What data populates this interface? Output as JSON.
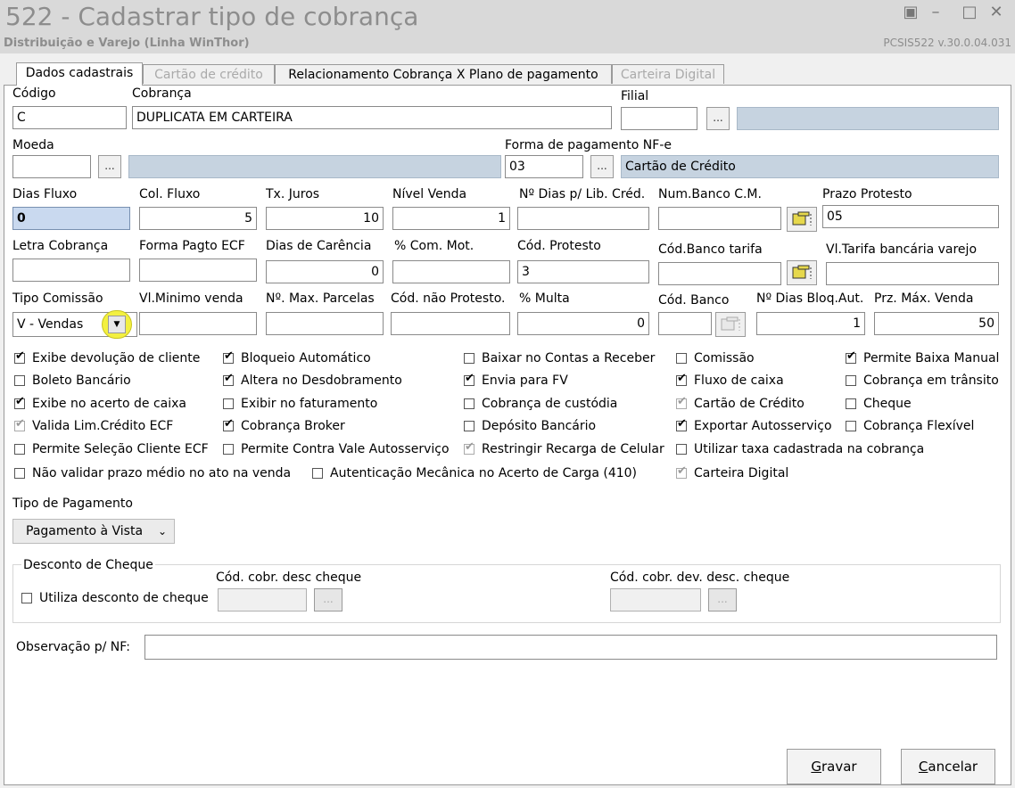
{
  "window": {
    "title": "522 - Cadastrar tipo de cobrança",
    "subtitle": "Distribuição e Varejo (Linha WinThor)",
    "version": "PCSIS522  v.30.0.04.031"
  },
  "tabs": [
    {
      "label": "Dados cadastrais"
    },
    {
      "label": "Cartão de crédito"
    },
    {
      "label": "Relacionamento Cobrança X Plano de pagamento"
    },
    {
      "label": "Carteira Digital"
    }
  ],
  "fields": {
    "codigo": {
      "label": "Código",
      "value": "C"
    },
    "cobranca": {
      "label": "Cobrança",
      "value": "DUPLICATA EM CARTEIRA"
    },
    "filial": {
      "label": "Filial",
      "value": ""
    },
    "moeda": {
      "label": "Moeda",
      "value": ""
    },
    "forma_pagamento_nfe": {
      "label": "Forma de pagamento NF-e",
      "value": "03",
      "desc": "Cartão de Crédito"
    },
    "dias_fluxo": {
      "label": "Dias Fluxo",
      "value": "0"
    },
    "col_fluxo": {
      "label": "Col. Fluxo",
      "value": "5"
    },
    "tx_juros": {
      "label": "Tx. Juros",
      "value": "10"
    },
    "nivel_venda": {
      "label": "Nível Venda",
      "value": "1"
    },
    "dias_lib_cred": {
      "label": "Nº Dias p/ Lib. Créd.",
      "value": ""
    },
    "num_banco_cm": {
      "label": "Num.Banco C.M.",
      "value": ""
    },
    "prazo_protesto": {
      "label": "Prazo Protesto",
      "value": "05"
    },
    "letra_cobranca": {
      "label": "Letra Cobrança",
      "value": ""
    },
    "forma_pagto_ecf": {
      "label": "Forma Pagto ECF",
      "value": ""
    },
    "dias_carencia": {
      "label": "Dias de Carência",
      "value": "0"
    },
    "com_mot": {
      "label": "% Com. Mot.",
      "value": ""
    },
    "cod_protesto": {
      "label": "Cód. Protesto",
      "value": "3"
    },
    "cod_banco_tarifa": {
      "label": "Cód.Banco tarifa",
      "value": ""
    },
    "vl_tarifa": {
      "label": "Vl.Tarifa bancária varejo",
      "value": ""
    },
    "tipo_comissao": {
      "label": "Tipo Comissão",
      "value": "V - Vendas"
    },
    "vl_minimo_venda": {
      "label": "Vl.Minimo venda",
      "value": ""
    },
    "max_parcelas": {
      "label": "Nº. Max. Parcelas",
      "value": ""
    },
    "cod_nao_protesto": {
      "label": "Cód. não Protesto.",
      "value": ""
    },
    "multa": {
      "label": "% Multa",
      "value": "0"
    },
    "cod_banco": {
      "label": "Cód. Banco",
      "value": ""
    },
    "dias_bloq_aut": {
      "label": "Nº Dias Bloq.Aut.",
      "value": "1"
    },
    "prz_max_venda": {
      "label": "Prz. Máx. Venda",
      "value": "50"
    }
  },
  "checkboxes": [
    {
      "label": "Exibe devolução de cliente",
      "checked": true,
      "disabled": false
    },
    {
      "label": "Bloqueio Automático",
      "checked": true,
      "disabled": false
    },
    {
      "label": "Baixar no Contas a Receber",
      "checked": false,
      "disabled": false
    },
    {
      "label": "Comissão",
      "checked": false,
      "disabled": false
    },
    {
      "label": "Permite Baixa Manual",
      "checked": true,
      "disabled": false
    },
    {
      "label": "Boleto Bancário",
      "checked": false,
      "disabled": false
    },
    {
      "label": "Altera no Desdobramento",
      "checked": true,
      "disabled": false
    },
    {
      "label": "Envia para FV",
      "checked": true,
      "disabled": false
    },
    {
      "label": "Fluxo de caixa",
      "checked": true,
      "disabled": false
    },
    {
      "label": "Cobrança em trânsito",
      "checked": false,
      "disabled": false
    },
    {
      "label": "Exibe no acerto de caixa",
      "checked": true,
      "disabled": false
    },
    {
      "label": "Exibir no faturamento",
      "checked": false,
      "disabled": false
    },
    {
      "label": "Cobrança de custódia",
      "checked": false,
      "disabled": false
    },
    {
      "label": "Cartão de Crédito",
      "checked": true,
      "disabled": true
    },
    {
      "label": "Cheque",
      "checked": false,
      "disabled": false
    },
    {
      "label": "Valida Lim.Crédito ECF",
      "checked": true,
      "disabled": true
    },
    {
      "label": "Cobrança Broker",
      "checked": true,
      "disabled": false
    },
    {
      "label": "Depósito Bancário",
      "checked": false,
      "disabled": false
    },
    {
      "label": "Exportar Autosserviço",
      "checked": true,
      "disabled": false
    },
    {
      "label": "Cobrança Flexível",
      "checked": false,
      "disabled": false
    },
    {
      "label": "Permite Seleção Cliente ECF",
      "checked": false,
      "disabled": false
    },
    {
      "label": "Permite Contra Vale Autosserviço",
      "checked": false,
      "disabled": false
    },
    {
      "label": "Restringir Recarga de Celular",
      "checked": true,
      "disabled": true
    },
    {
      "label": "Utilizar taxa cadastrada na cobrança",
      "checked": false,
      "disabled": false
    },
    {
      "label": "Não validar prazo médio no ato na venda",
      "checked": false,
      "disabled": false
    },
    {
      "label": "Autenticação Mecânica no Acerto de Carga (410)",
      "checked": false,
      "disabled": false
    },
    {
      "label": "Carteira Digital",
      "checked": true,
      "disabled": true
    }
  ],
  "tipo_pagamento": {
    "label": "Tipo de Pagamento",
    "value": "Pagamento à Vista"
  },
  "desconto_cheque": {
    "title": "Desconto de Cheque",
    "utiliza_label": "Utiliza desconto de cheque",
    "cod_cobr_label": "Cód. cobr. desc cheque",
    "cod_cobr_dev_label": "Cód. cobr. dev. desc. cheque"
  },
  "observacao": {
    "label": "Observação p/ NF:",
    "value": ""
  },
  "buttons": {
    "ellipsis": "...",
    "gravar_first": "G",
    "gravar_rest": "ravar",
    "cancelar_first": "C",
    "cancelar_rest": "ancelar"
  }
}
